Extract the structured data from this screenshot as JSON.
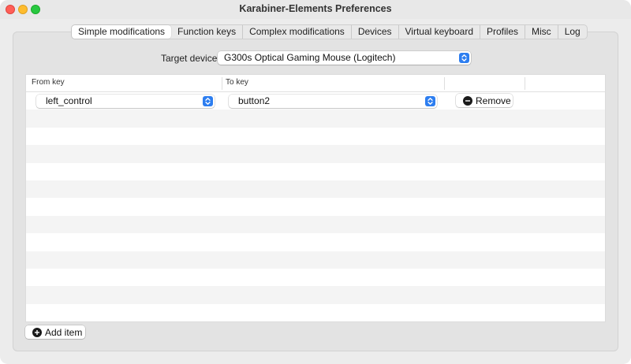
{
  "window": {
    "title": "Karabiner-Elements Preferences"
  },
  "tabs": [
    {
      "label": "Simple modifications",
      "active": true
    },
    {
      "label": "Function keys",
      "active": false
    },
    {
      "label": "Complex modifications",
      "active": false
    },
    {
      "label": "Devices",
      "active": false
    },
    {
      "label": "Virtual keyboard",
      "active": false
    },
    {
      "label": "Profiles",
      "active": false
    },
    {
      "label": "Misc",
      "active": false
    },
    {
      "label": "Log",
      "active": false
    }
  ],
  "target_device": {
    "label": "Target device:",
    "value": "G300s Optical Gaming Mouse (Logitech)"
  },
  "table": {
    "columns": {
      "from": "From key",
      "to": "To key"
    },
    "rows": [
      {
        "from": "left_control",
        "to": "button2",
        "remove_label": "Remove"
      }
    ]
  },
  "add_item_label": "Add item",
  "colors": {
    "accent": "#2d7ef0",
    "close": "#ff5f57",
    "minimize": "#febc2e",
    "maximize": "#28c840"
  }
}
